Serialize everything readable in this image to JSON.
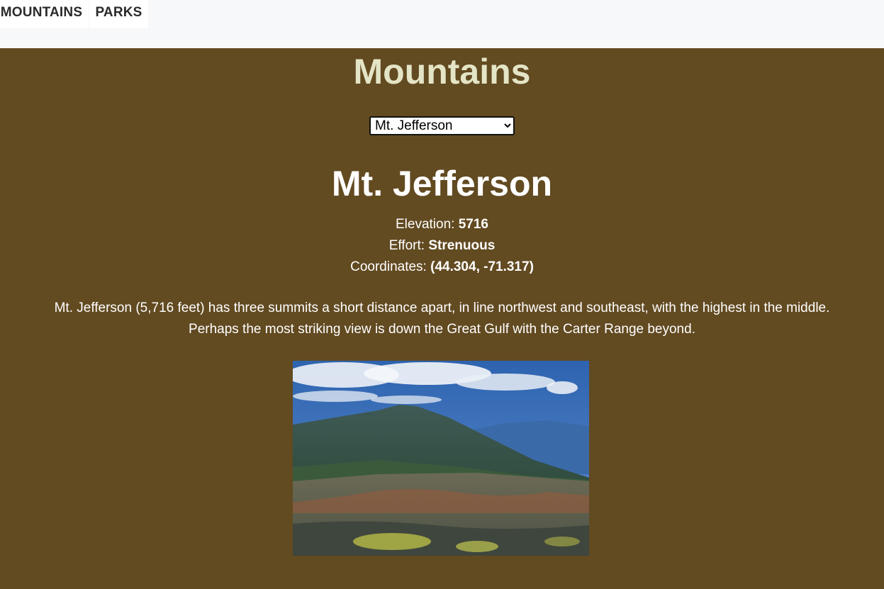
{
  "nav": {
    "mountains_label": "MOUNTAINS",
    "parks_label": "PARKS"
  },
  "page": {
    "title": "Mountains"
  },
  "select": {
    "selected": "Mt. Jefferson"
  },
  "mountain": {
    "name": "Mt. Jefferson",
    "elevation_label": "Elevation: ",
    "elevation": "5716",
    "effort_label": "Effort: ",
    "effort": "Strenuous",
    "coordinates_label": "Coordinates: ",
    "coordinates": "(44.304, -71.317)",
    "description_line1": "Mt. Jefferson (5,716 feet) has three summits a short distance apart, in line northwest and southeast, with the highest in the middle.",
    "description_line2": "Perhaps the most striking view is down the Great Gulf with the Carter Range beyond."
  },
  "colors": {
    "main_bg": "#624a21",
    "title_color": "#e4e4c6",
    "nav_bg": "#f7f8fa"
  }
}
